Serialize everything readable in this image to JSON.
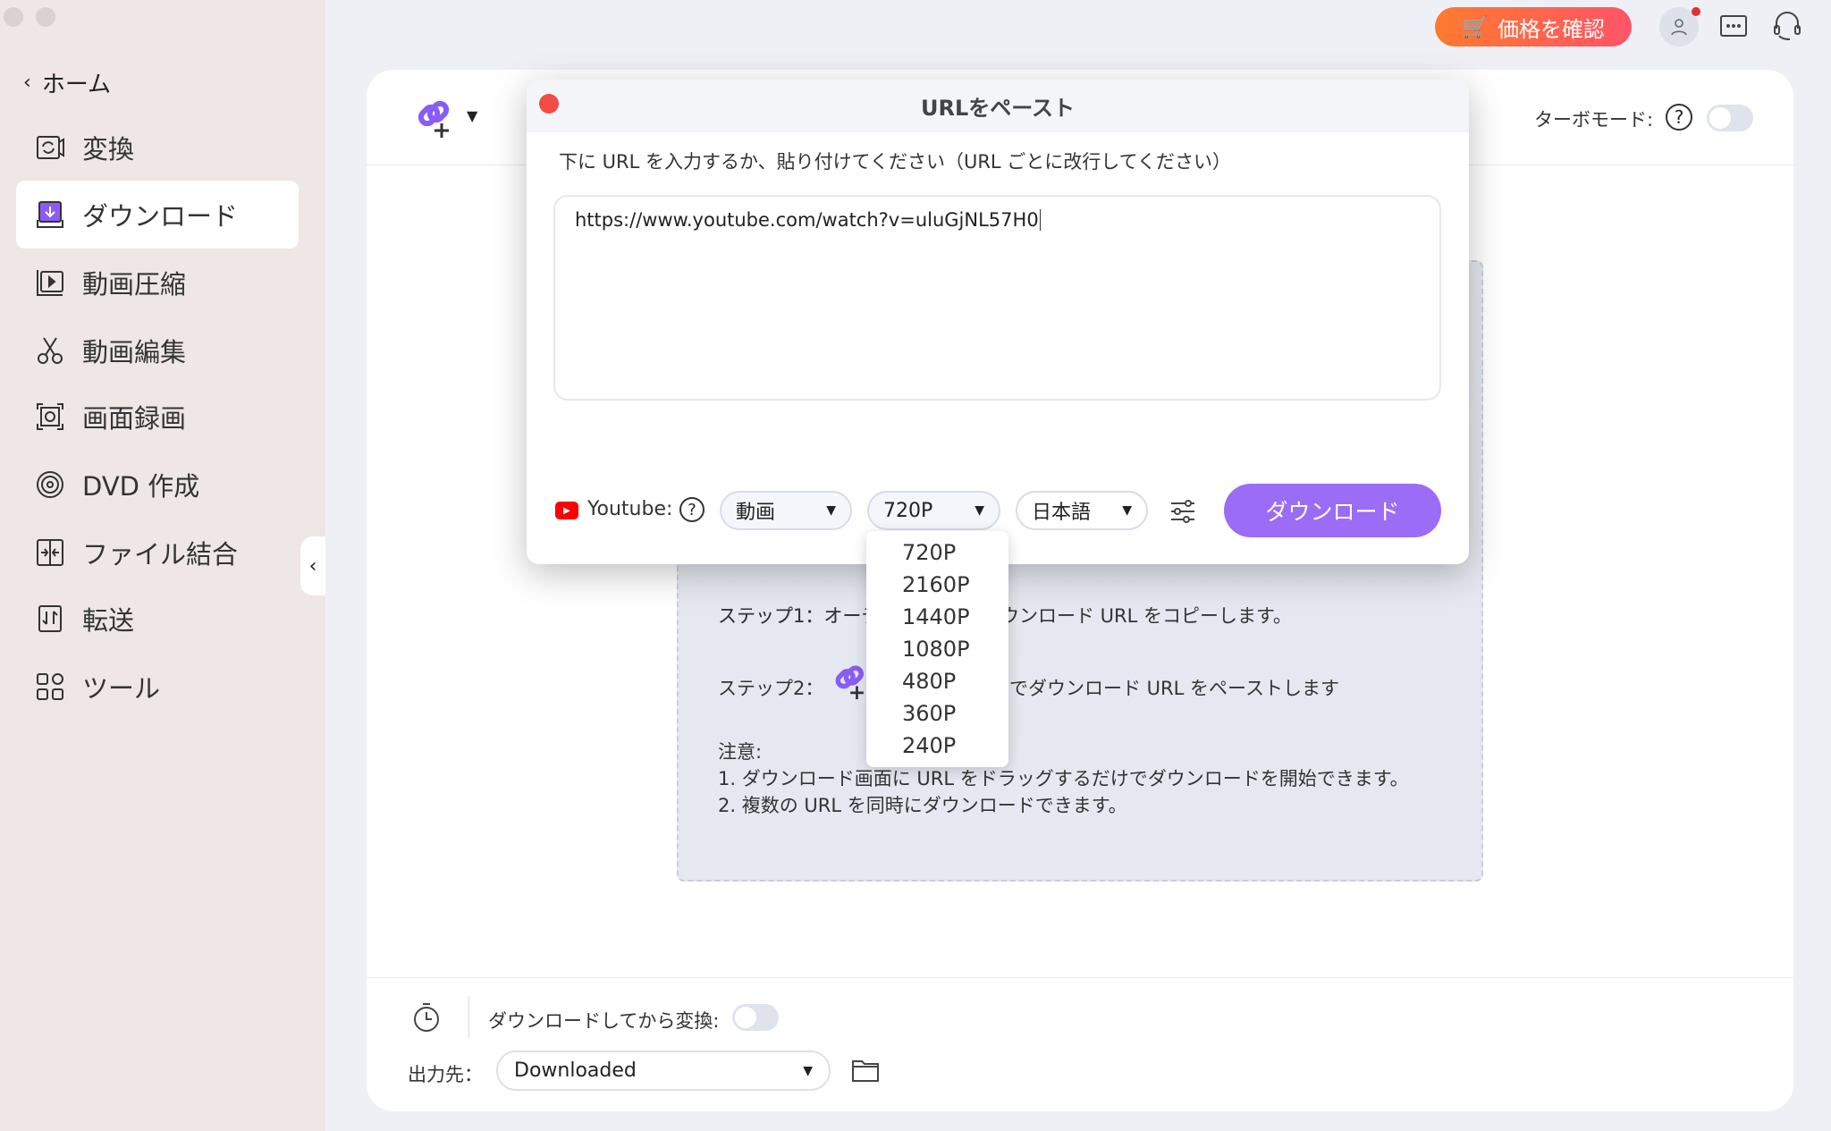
{
  "sidebar": {
    "back_label": "ホーム",
    "items": [
      {
        "label": "変換",
        "icon": "convert-icon"
      },
      {
        "label": "ダウンロード",
        "icon": "download-icon",
        "active": true
      },
      {
        "label": "動画圧縮",
        "icon": "compress-icon"
      },
      {
        "label": "動画編集",
        "icon": "scissors-icon"
      },
      {
        "label": "画面録画",
        "icon": "record-icon"
      },
      {
        "label": "DVD 作成",
        "icon": "dvd-icon"
      },
      {
        "label": "ファイル結合",
        "icon": "merge-icon"
      },
      {
        "label": "転送",
        "icon": "transfer-icon"
      },
      {
        "label": "ツール",
        "icon": "tools-icon"
      }
    ]
  },
  "topbar": {
    "price_button": "価格を確認",
    "accent": "#ff6a3d"
  },
  "header": {
    "turbo_label": "ターボモード:",
    "turbo_on": false
  },
  "instructions": {
    "step1": "ステップ1：オーディオ/ビデオのダウンロードURLをコピーします。",
    "step1_visible_left": "ステップ1：オー",
    "step1_visible_right": "ウンロード URL をコピーします。",
    "step2_left": "ステップ2：",
    "step2_right": "でダウンロード URL をペーストします",
    "note_title": "注意:",
    "note1": "1. ダウンロード画面に URL をドラッグするだけでダウンロードを開始できます。",
    "note2": "2. 複数の URL を同時にダウンロードできます。"
  },
  "dialog": {
    "title": "URLをペースト",
    "instruction": "下に URL を入力するか、貼り付けてください（URL ごとに改行してください）",
    "url_value": "https://www.youtube.com/watch?v=uluGjNL57H0",
    "site_label": "Youtube:",
    "type_select": "動画",
    "quality_select": "720P",
    "language_select": "日本語",
    "download_button": "ダウンロード",
    "button_color": "#9b6cf6"
  },
  "quality_options": [
    "720P",
    "2160P",
    "1440P",
    "1080P",
    "480P",
    "360P",
    "240P"
  ],
  "footer": {
    "convert_label": "ダウンロードしてから変換:",
    "convert_on": false,
    "output_label": "出力先：",
    "output_value": "Downloaded"
  }
}
